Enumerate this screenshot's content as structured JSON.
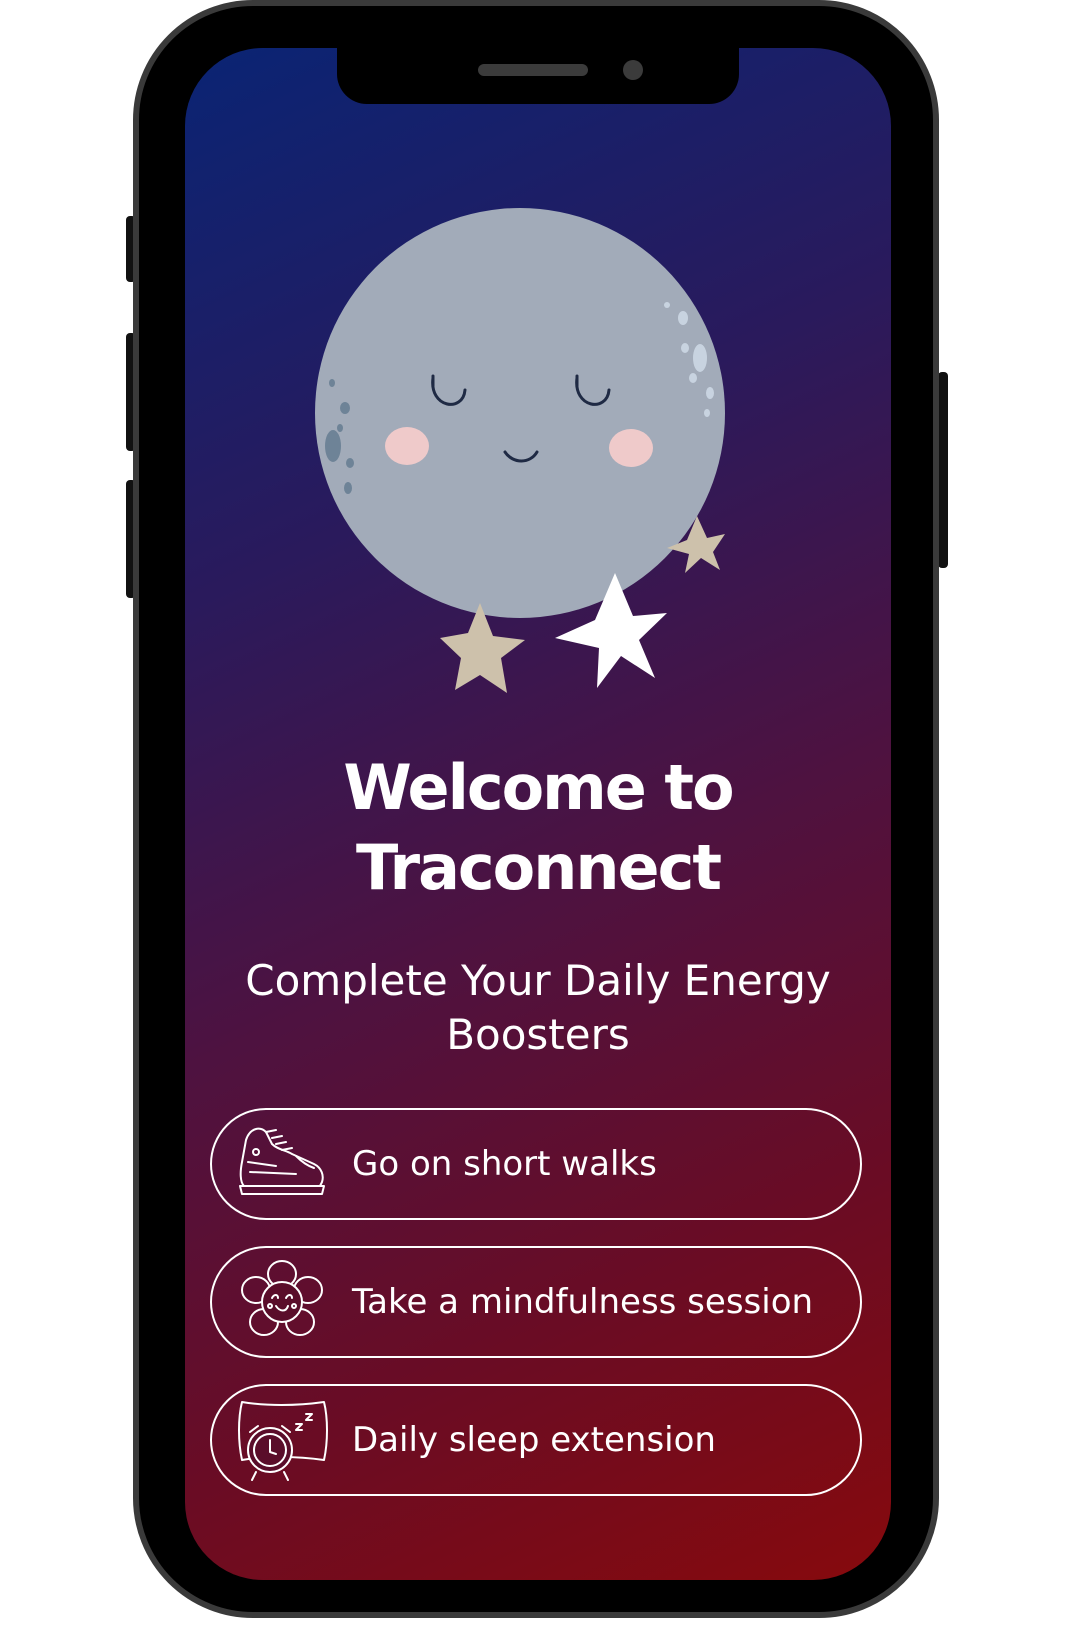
{
  "screen": {
    "title_line1": "Welcome to",
    "title_line2": "Traconnect",
    "subtitle": "Complete Your Daily Energy Boosters"
  },
  "illustration": {
    "icon": "sleeping-moon-with-stars-icon"
  },
  "boosters": [
    {
      "label": "Go on short walks",
      "icon": "sneaker-icon"
    },
    {
      "label": "Take a mindfulness session",
      "icon": "smiling-flower-icon"
    },
    {
      "label": "Daily sleep extension",
      "icon": "alarm-clock-pillow-icon"
    }
  ],
  "colors": {
    "gradient_top": "#0a2474",
    "gradient_bottom": "#870a0d",
    "moon": "#a2abb9",
    "text": "#ffffff"
  }
}
